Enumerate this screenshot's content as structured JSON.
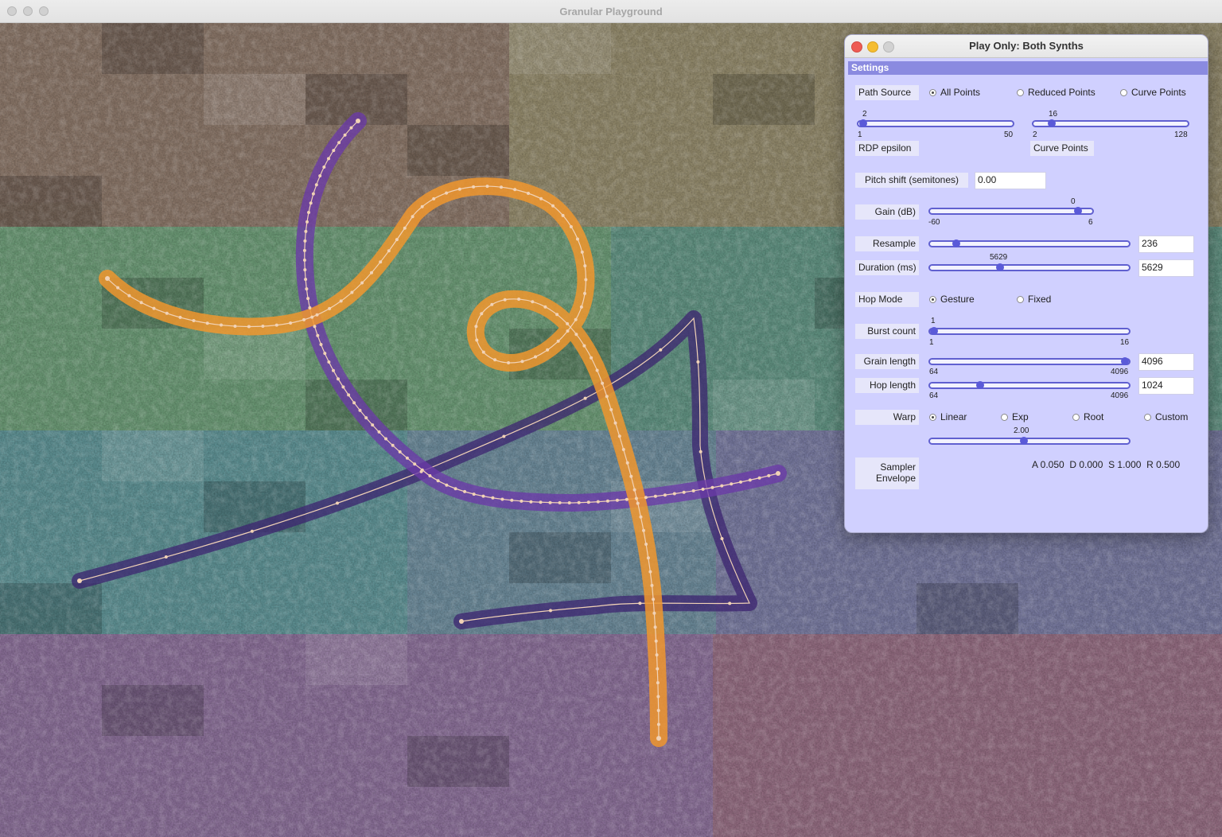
{
  "window": {
    "title": "Granular Playground"
  },
  "panel": {
    "title": "Play Only: Both Synths",
    "section": "Settings",
    "path_source": {
      "label": "Path Source",
      "options": [
        "All Points",
        "Reduced Points",
        "Curve Points"
      ],
      "selected": "All Points"
    },
    "rdp": {
      "label": "RDP epsilon",
      "value": "2",
      "min": "1",
      "max": "50",
      "fraction": 0.03
    },
    "curve_points": {
      "label": "Curve Points",
      "value": "16",
      "min": "2",
      "max": "128",
      "fraction": 0.12
    },
    "pitch": {
      "label": "Pitch shift (semitones)",
      "value": "0.00"
    },
    "gain": {
      "label": "Gain (dB)",
      "value": "0",
      "min": "-60",
      "max": "6",
      "fraction": 0.91
    },
    "resample": {
      "label": "Resample",
      "value": "236",
      "fraction": 0.13
    },
    "duration": {
      "label": "Duration (ms)",
      "value": "5629",
      "field": "5629",
      "fraction": 0.35
    },
    "hop_mode": {
      "label": "Hop Mode",
      "options": [
        "Gesture",
        "Fixed"
      ],
      "selected": "Gesture"
    },
    "burst": {
      "label": "Burst count",
      "value": "1",
      "min": "1",
      "max": "16",
      "fraction": 0.0
    },
    "grain_length": {
      "label": "Grain length",
      "value": "4096",
      "min": "64",
      "max": "4096",
      "fraction": 0.99
    },
    "hop_length": {
      "label": "Hop length",
      "value": "1024",
      "min": "64",
      "max": "4096",
      "fraction": 0.25
    },
    "warp": {
      "label": "Warp",
      "options": [
        "Linear",
        "Exp",
        "Root",
        "Custom"
      ],
      "selected": "Linear",
      "value": "2.00",
      "fraction": 0.47
    },
    "envelope": {
      "label_line1": "Sampler",
      "label_line2": "Envelope",
      "adsr": "A 0.050  D 0.000  S 1.000  R 0.500"
    }
  },
  "colors": {
    "band_rows": [
      "#8a7a6e",
      "#6e9a6e",
      "#6a8a9a",
      "#8a6a9a"
    ],
    "orange_curve": "#f0962e",
    "purple_curve": "#6a3aa8",
    "dark_purple_curve": "#3c2470",
    "point": "#f1d2b6",
    "panel_bg": "#d0d0ff",
    "slider": "#6060d0"
  }
}
